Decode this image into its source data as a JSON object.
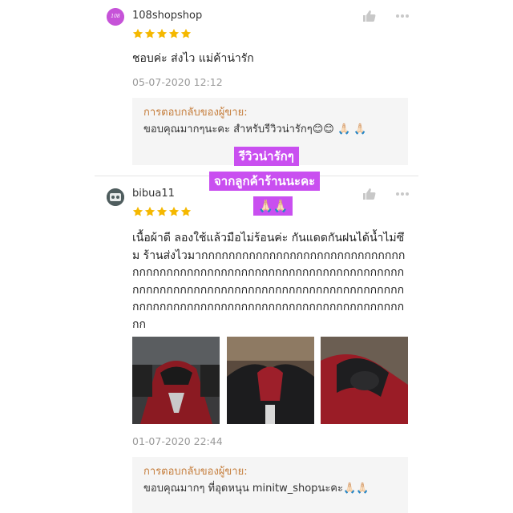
{
  "reviews": [
    {
      "username": "108shopshop",
      "avatar_text": "108",
      "rating": 5,
      "comment": "ชอบค่ะ ส่งไว แม่ค้าน่ารัก",
      "timestamp": "05-07-2020 12:12",
      "reply_title": "การตอบกลับของผู้ขาย:",
      "reply_text": "ขอบคุณมากๆนะคะ สำหรับรีวิวน่ารักๆ😊😊 🙏🏻 🙏🏻"
    },
    {
      "username": "bibua11",
      "rating": 5,
      "comment": "เนื้อผ้าดี ลองใช้แล้วมือไม่ร้อนค่ะ กันแดดกันฝนได้น้ำไม่ซึม ร้านส่งไวมากกกกกกกกกกกกกกกกกกกกกกกกกกกกกกกกกกกกกกกกกกกกกกกกกกกกกกกกกกกกกกกกกกกกกกกกกกกกกกกกกกกกกกกกกกกกกกกกกกกกกกกกกกกกกกกกกกกกกกกกกกกกกกกกกกกกกกกกกกกกกกกกกกกกกกกก",
      "timestamp": "01-07-2020 22:44",
      "reply_title": "การตอบกลับของผู้ขาย:",
      "reply_text": "ขอบคุณมากๆ ที่อุดหนุน minitw_shopนะคะ🙏🏻🙏🏻",
      "photos": [
        "motorcycle-photo-1",
        "motorcycle-photo-2",
        "motorcycle-photo-3"
      ]
    }
  ],
  "overlay": {
    "line1": "รีวิวน่ารักๆ",
    "line2": "จากลูกค้าร้านนะคะ",
    "line3": "🙏🏻🙏🏻"
  },
  "colors": {
    "star": "#f5b800",
    "reply_title": "#c57d3b",
    "overlay_bg": "#c94ff0",
    "timestamp": "#999999"
  },
  "icons": [
    "like-icon",
    "more-icon",
    "star-icon"
  ]
}
